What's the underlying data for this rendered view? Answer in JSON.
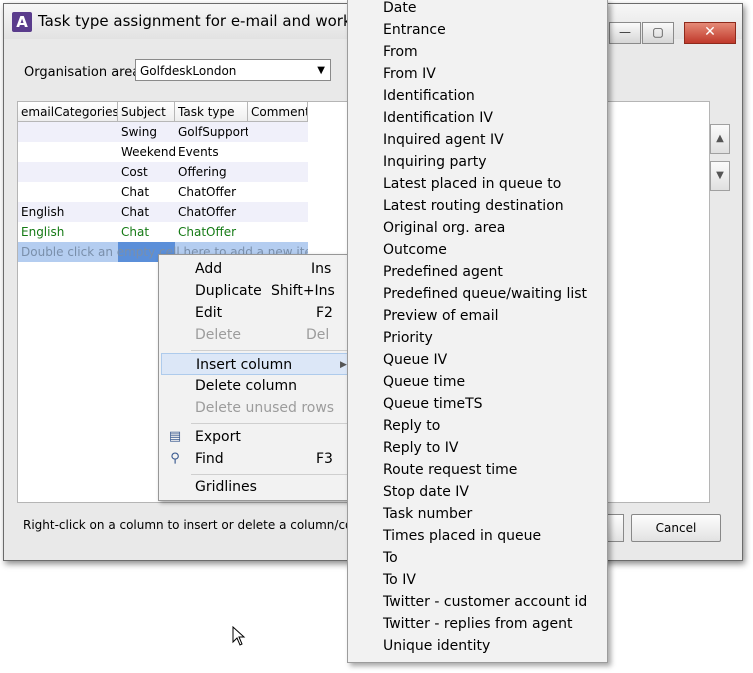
{
  "window": {
    "title": "Task type assignment for e-mail and work item",
    "app_icon_glyph": "A",
    "minimize_glyph": "—",
    "maximize_glyph": "▢",
    "close_glyph": "✕"
  },
  "org": {
    "label": "Organisation area",
    "value": "GolfdeskLondon"
  },
  "grid": {
    "columns": [
      "emailCategories",
      "Subject",
      "Task type",
      "Comment"
    ],
    "rows": [
      {
        "emailCategories": "",
        "subject": "Swing",
        "task_type": "GolfSupport",
        "comment": ""
      },
      {
        "emailCategories": "",
        "subject": "Weekend",
        "task_type": "Events",
        "comment": ""
      },
      {
        "emailCategories": "",
        "subject": "Cost",
        "task_type": "Offering",
        "comment": ""
      },
      {
        "emailCategories": "",
        "subject": "Chat",
        "task_type": "ChatOffer",
        "comment": ""
      },
      {
        "emailCategories": "English",
        "subject": "Chat",
        "task_type": "ChatOffer",
        "comment": ""
      },
      {
        "emailCategories": "English",
        "subject": "Chat",
        "task_type": "ChatOffer",
        "comment": ""
      }
    ],
    "new_row_hint": "Double click an empty cell here to add a new item",
    "scroll_up_glyph": "▲",
    "scroll_down_glyph": "▼"
  },
  "hint_text": "Right-click on a column to insert or delete a column/conta",
  "buttons": {
    "cancel": "Cancel"
  },
  "context_menu": {
    "items": [
      {
        "label": "Add",
        "shortcut": "Ins",
        "disabled": false
      },
      {
        "label": "Duplicate",
        "shortcut": "Shift+Ins",
        "disabled": false
      },
      {
        "label": "Edit",
        "shortcut": "F2",
        "disabled": false
      },
      {
        "label": "Delete",
        "shortcut": "Del",
        "disabled": true
      },
      {
        "label": "Insert column",
        "shortcut": "",
        "disabled": false
      },
      {
        "label": "Delete column",
        "shortcut": "",
        "disabled": false
      },
      {
        "label": "Delete unused rows",
        "shortcut": "",
        "disabled": true
      },
      {
        "label": "Export",
        "shortcut": "",
        "disabled": false
      },
      {
        "label": "Find",
        "shortcut": "F3",
        "disabled": false
      },
      {
        "label": "Gridlines",
        "shortcut": "",
        "disabled": false
      }
    ],
    "submenu_arrow": "▶"
  },
  "submenu": {
    "items": [
      "Date",
      "Entrance",
      "From",
      "From IV",
      "Identification",
      "Identification IV",
      "Inquired agent IV",
      "Inquiring party",
      "Latest placed in queue to",
      "Latest routing destination",
      "Original org. area",
      "Outcome",
      "Predefined agent",
      "Predefined queue/waiting list",
      "Preview of email",
      "Priority",
      "Queue IV",
      "Queue time",
      "Queue timeTS",
      "Reply to",
      "Reply to IV",
      "Route request time",
      "Stop date IV",
      "Task number",
      "Times placed in queue",
      "To",
      "To IV",
      "Twitter - customer account id",
      "Twitter - replies from agent",
      "Unique identity"
    ]
  }
}
